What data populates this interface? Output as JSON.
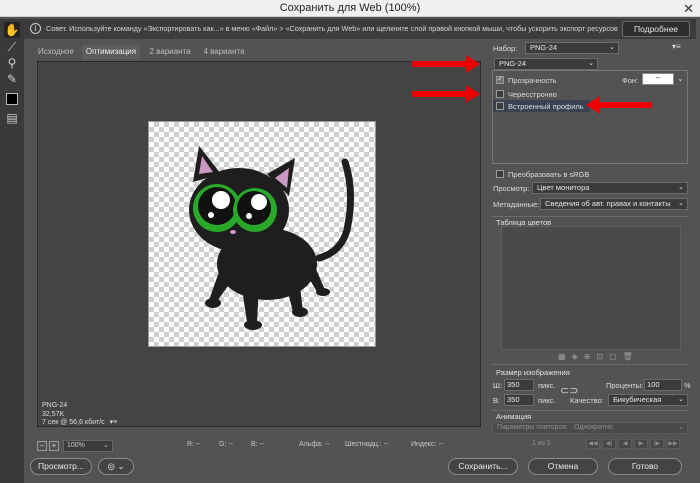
{
  "window": {
    "title": "Сохранить для Web (100%)",
    "close_glyph": "✕"
  },
  "infobar": {
    "icon": "i",
    "message": "Совет. Используйте команду «Экспортировать как...» в меню «Файл» > «Сохранить для Web» или щелкните слой правой кнопкой мыши, чтобы ускорить экспорт ресурсов",
    "more_button": "Подробнее"
  },
  "tools": [
    {
      "name": "hand-tool",
      "glyph": "✋"
    },
    {
      "name": "slice-select-tool",
      "glyph": "⟋"
    },
    {
      "name": "zoom-tool",
      "glyph": "⚲"
    },
    {
      "name": "eyedropper-tool",
      "glyph": "✎"
    },
    {
      "name": "preview-toggle",
      "glyph": "▤"
    }
  ],
  "tabs": [
    "Исходное",
    "Оптимизация",
    "2 варианта",
    "4 варианта"
  ],
  "status": {
    "format": "PNG-24",
    "size": "32,57K",
    "time": "7 сек @ 56,6 кбит/с",
    "menu": "▾≡"
  },
  "bottombar": {
    "zoom": "100%",
    "r": "R: --",
    "g": "G: --",
    "b": "B: --",
    "alpha": "Альфа: --",
    "hex": "Шестнадц.: --",
    "index": "Индекс: --"
  },
  "footer": {
    "preview_button": "Просмотр...",
    "save_button": "Сохранить...",
    "cancel_button": "Отмена",
    "done_button": "Готово"
  },
  "settings": {
    "preset_label": "Набор:",
    "preset_value": "PNG-24",
    "format_value": "PNG-24",
    "transparency": {
      "label": "Прозрачность",
      "checked": true
    },
    "matte_label": "Фон:",
    "matte_value": "--",
    "interlaced": {
      "label": "Чересстрочно",
      "checked": false
    },
    "embed_profile": {
      "label": "Встроенный профиль",
      "checked": false
    },
    "convert_srgb": {
      "label": "Преобразовать в sRGB",
      "checked": false
    },
    "preview_label": "Просмотр:",
    "preview_value": "Цвет монитора",
    "metadata_label": "Метаданные:",
    "metadata_value": "Сведения об авт. правах и контакты"
  },
  "color_table": {
    "title": "Таблица цветов",
    "icons": "▦◈⊕⊡▢🗑"
  },
  "image_size": {
    "title": "Размер изображения",
    "width_label": "Ш:",
    "width_value": "350",
    "width_unit": "пикс.",
    "height_label": "В:",
    "height_value": "350",
    "height_unit": "пикс.",
    "percent_label": "Проценты:",
    "percent_value": "100",
    "percent_unit": "%",
    "quality_label": "Качество:",
    "quality_value": "Бикубическая"
  },
  "animation": {
    "title": "Анимация",
    "loop_label": "Параметры повторов:",
    "loop_value": "Однократно",
    "frame_counter": "1 из 1",
    "controls": [
      "◀◀",
      "◀|",
      "◀",
      "▶",
      "|▶",
      "▶▶"
    ]
  }
}
